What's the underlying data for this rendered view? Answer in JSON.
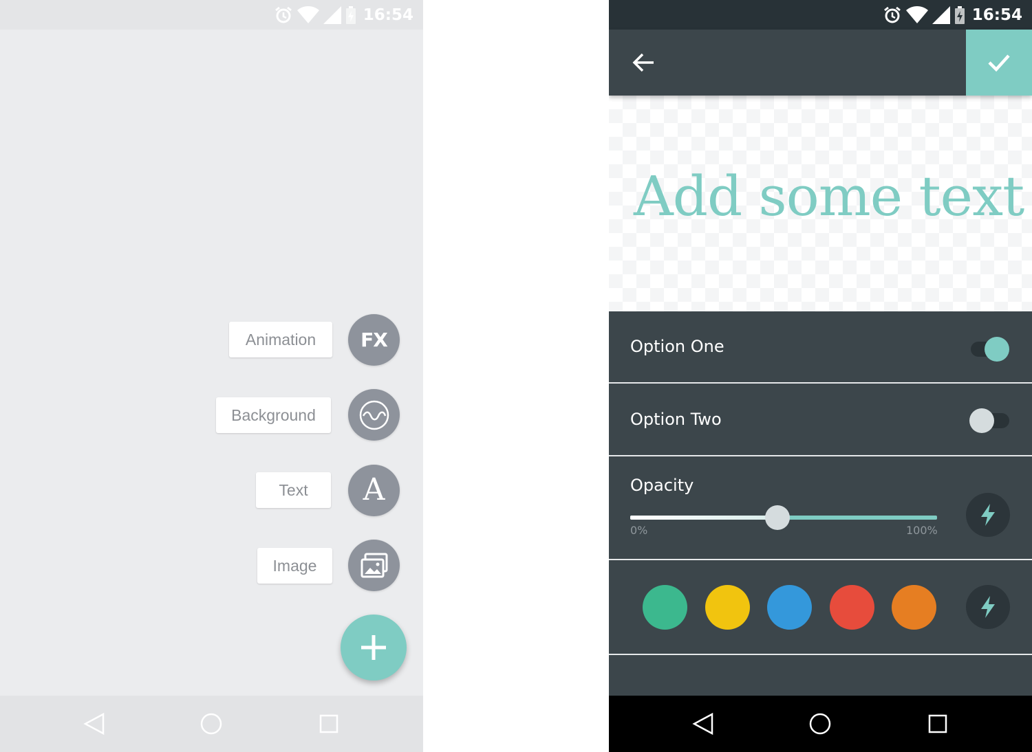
{
  "status_bar": {
    "time": "16:54"
  },
  "left": {
    "menu": [
      {
        "label": "Animation",
        "icon": "fx-icon",
        "icon_text": "FX"
      },
      {
        "label": "Background",
        "icon": "wave-icon"
      },
      {
        "label": "Text",
        "icon": "text-icon",
        "icon_text": "A"
      },
      {
        "label": "Image",
        "icon": "image-icon"
      }
    ],
    "fab_icon": "plus-icon"
  },
  "right": {
    "canvas_text": "Add some text",
    "options": [
      {
        "label": "Option One",
        "enabled": true
      },
      {
        "label": "Option Two",
        "enabled": false
      }
    ],
    "opacity": {
      "label": "Opacity",
      "min_label": "0%",
      "max_label": "100%",
      "value_percent": 48
    },
    "colors": [
      "#3cb88e",
      "#f1c40f",
      "#3498db",
      "#e74c3c",
      "#e67e22"
    ]
  },
  "nav_bar": {
    "buttons": [
      "back-icon",
      "home-icon",
      "recents-icon"
    ]
  },
  "theme": {
    "accent": "#7fccc3",
    "panel": "#3c464b",
    "fab_grey": "#8e939c"
  }
}
